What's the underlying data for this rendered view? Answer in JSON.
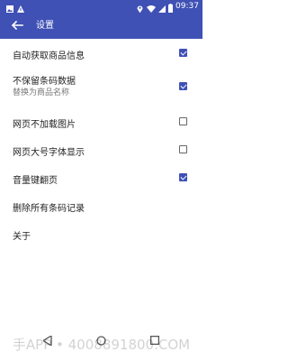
{
  "status_bar": {
    "time": "09:37",
    "icons": [
      "image-icon",
      "warning-icon",
      "location-pin-icon",
      "wifi-icon",
      "signal-icon",
      "battery-icon"
    ]
  },
  "app_bar": {
    "title": "设置"
  },
  "settings": [
    {
      "label": "自动获取商品信息",
      "checked": true
    },
    {
      "label": "不保留条码数据",
      "subtitle": "替换为商品名称",
      "checked": true
    },
    {
      "label": "网页不加载图片",
      "checked": false
    },
    {
      "label": "网页大号字体显示",
      "checked": false
    },
    {
      "label": "音量键翻页",
      "checked": true
    },
    {
      "label": "删除所有条码记录"
    },
    {
      "label": "关于"
    }
  ],
  "watermark": "手APP • 4008891800.COM",
  "colors": {
    "primary": "#3f51b5"
  }
}
